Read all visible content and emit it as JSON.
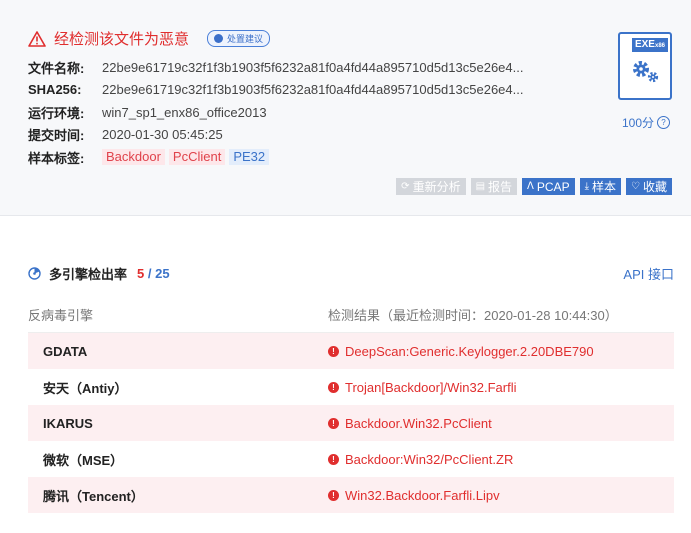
{
  "header": {
    "warning": "经检测该文件为恶意",
    "advice_label": "处置建议"
  },
  "info": {
    "filename_label": "文件名称:",
    "filename": "22be9e61719c32f1f3b1903f5f6232a81f0a4fd44a895710d5d13c5e26e4...",
    "sha256_label": "SHA256:",
    "sha256": "22be9e61719c32f1f3b1903f5f6232a81f0a4fd44a895710d5d13c5e26e4...",
    "env_label": "运行环境:",
    "env": "win7_sp1_enx86_office2013",
    "time_label": "提交时间:",
    "time": "2020-01-30 05:45:25",
    "tags_label": "样本标签:",
    "tags": [
      "Backdoor",
      "PcClient",
      "PE32"
    ]
  },
  "file_icon": {
    "label": "EXE",
    "sub": "x86"
  },
  "score": "100分",
  "actions": {
    "reanalyze": "重新分析",
    "report": "报告",
    "pcap": "PCAP",
    "sample": "样本",
    "favorite": "收藏"
  },
  "engines": {
    "title": "多引擎检出率",
    "detected": "5",
    "separator": "/",
    "total": "25",
    "api_link": "API 接口",
    "col_engine": "反病毒引擎",
    "col_result": "检测结果（最近检测时间：2020-01-28 10:44:30）",
    "rows": [
      {
        "engine": "GDATA",
        "result": "DeepScan:Generic.Keylogger.2.20DBE790"
      },
      {
        "engine": "安天（Antiy）",
        "result": "Trojan[Backdoor]/Win32.Farfli"
      },
      {
        "engine": "IKARUS",
        "result": "Backdoor.Win32.PcClient"
      },
      {
        "engine": "微软（MSE）",
        "result": "Backdoor:Win32/PcClient.ZR"
      },
      {
        "engine": "腾讯（Tencent）",
        "result": "Win32.Backdoor.Farfli.Lipv"
      }
    ]
  },
  "colors": {
    "danger": "#e02e2e",
    "accent": "#3b73c9"
  }
}
